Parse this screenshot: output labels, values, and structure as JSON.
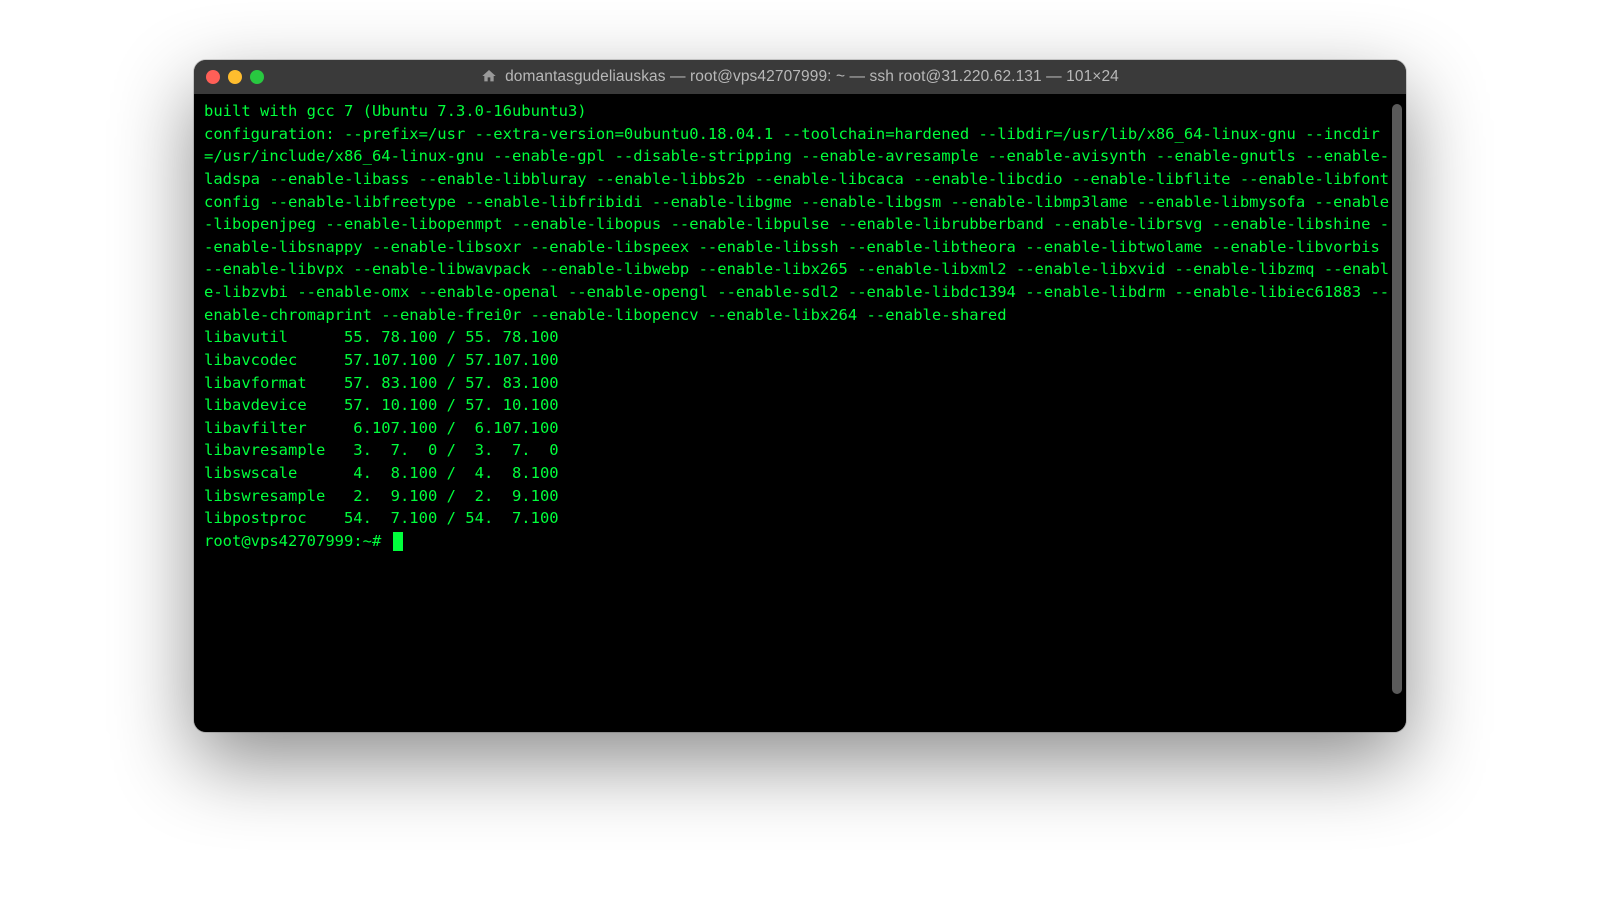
{
  "window": {
    "title": "domantasgudeliauskas — root@vps42707999: ~ — ssh root@31.220.62.131 — 101×24"
  },
  "output": {
    "line_built": "built with gcc 7 (Ubuntu 7.3.0-16ubuntu3)",
    "config": "configuration: --prefix=/usr --extra-version=0ubuntu0.18.04.1 --toolchain=hardened --libdir=/usr/lib/x86_64-linux-gnu --incdir=/usr/include/x86_64-linux-gnu --enable-gpl --disable-stripping --enable-avresample --enable-avisynth --enable-gnutls --enable-ladspa --enable-libass --enable-libbluray --enable-libbs2b --enable-libcaca --enable-libcdio --enable-libflite --enable-libfontconfig --enable-libfreetype --enable-libfribidi --enable-libgme --enable-libgsm --enable-libmp3lame --enable-libmysofa --enable-libopenjpeg --enable-libopenmpt --enable-libopus --enable-libpulse --enable-librubberband --enable-librsvg --enable-libshine --enable-libsnappy --enable-libsoxr --enable-libspeex --enable-libssh --enable-libtheora --enable-libtwolame --enable-libvorbis --enable-libvpx --enable-libwavpack --enable-libwebp --enable-libx265 --enable-libxml2 --enable-libxvid --enable-libzmq --enable-libzvbi --enable-omx --enable-openal --enable-opengl --enable-sdl2 --enable-libdc1394 --enable-libdrm --enable-libiec61883 --enable-chromaprint --enable-frei0r --enable-libopencv --enable-libx264 --enable-shared",
    "libs": "libavutil      55. 78.100 / 55. 78.100\nlibavcodec     57.107.100 / 57.107.100\nlibavformat    57. 83.100 / 57. 83.100\nlibavdevice    57. 10.100 / 57. 10.100\nlibavfilter     6.107.100 /  6.107.100\nlibavresample   3.  7.  0 /  3.  7.  0\nlibswscale      4.  8.100 /  4.  8.100\nlibswresample   2.  9.100 /  2.  9.100\nlibpostproc    54.  7.100 / 54.  7.100",
    "prompt": "root@vps42707999:~# "
  }
}
